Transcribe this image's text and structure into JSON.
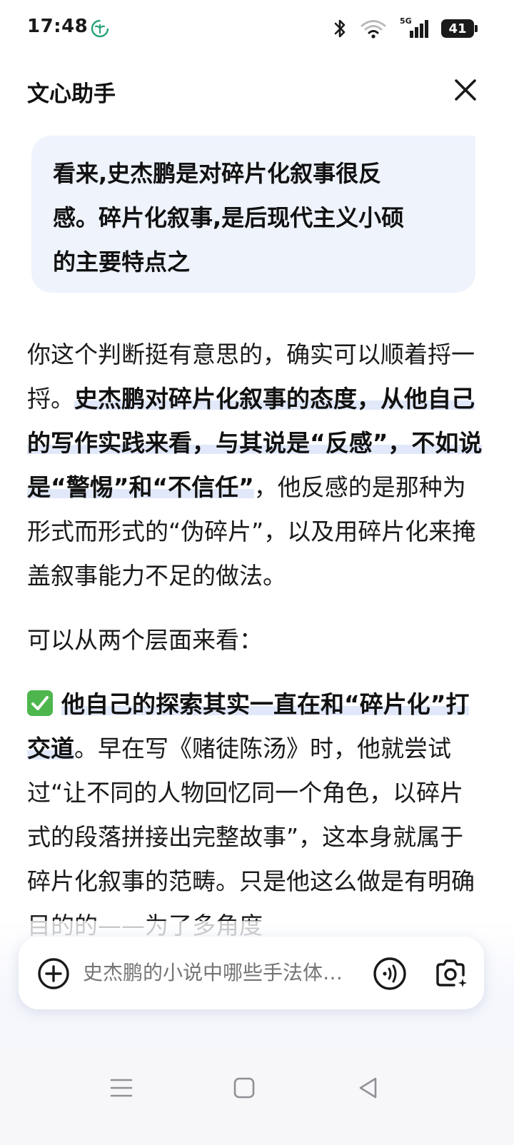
{
  "status_bar": {
    "time": "17:48",
    "network_label": "5G",
    "battery_level": "41",
    "icons": [
      "app-leaf-icon",
      "bluetooth-icon",
      "wifi-icon",
      "cellular-signal-icon",
      "battery-icon"
    ]
  },
  "header": {
    "title": "文心助手",
    "close_icon": "close-icon"
  },
  "user_message": {
    "lines": [
      "看来,史杰鹏是对碎片化叙事很反",
      "感。碎片化叙事,是后现代主义小硕",
      "的主要特点之"
    ]
  },
  "reply": {
    "p1_intro": "你这个判断挺有意思的，确实可以顺着捋一捋。",
    "p1_highlight": "史杰鹏对碎片化叙事的态度，从他自己的写作实践来看，与其说是“反感”，不如说是“警惕”和“不信任”",
    "p1_rest": "，他反感的是那种为形式而形式的“伪碎片”，以及用碎片化来掩盖叙事能力不足的做法。",
    "p2": "可以从两个层面来看：",
    "p3_highlight": "他自己的探索其实一直在和“碎片化”打交道",
    "p3_rest": "。早在写《赌徒陈汤》时，他就尝试过“让不同的人物回忆同一个角色，以碎片式的段落拼接出完整故事”，这本身就属于碎片化叙事的范畴。只是他这么做是有明确目的的——为了多角度"
  },
  "input_bar": {
    "placeholder": "史杰鹏的小说中哪些手法体…",
    "icons": [
      "plus-icon",
      "voice-icon",
      "camera-icon"
    ]
  },
  "nav_bar": {
    "icons": [
      "menu-icon",
      "home-icon",
      "back-icon"
    ]
  },
  "colors": {
    "bubble_bg": "#eef3fc",
    "highlight": "#e1e8fa",
    "check_green": "#4db64d",
    "placeholder": "#8a8d96"
  }
}
